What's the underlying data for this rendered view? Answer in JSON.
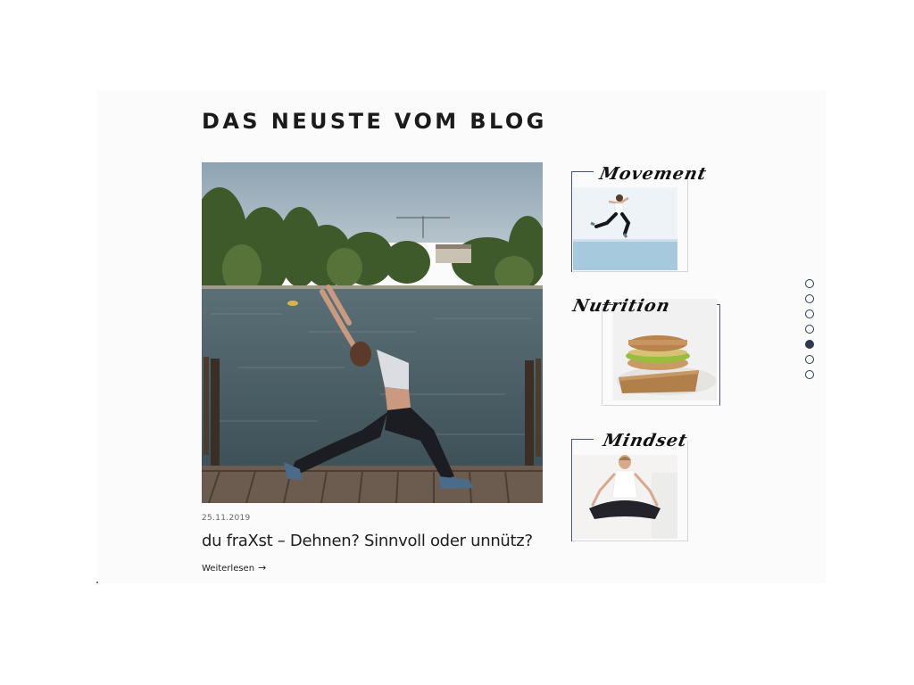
{
  "blog": {
    "heading": "DAS NEUSTE VOM BLOG",
    "post": {
      "date": "25.11.2019",
      "title": "du fraXst – Dehnen? Sinnvoll oder unnütz?",
      "read_more": "Weiterlesen",
      "read_more_arrow": "→",
      "image_icon": "yoga-stretch-lakeside-photo"
    },
    "categories": [
      {
        "label": "Movement",
        "icon": "jumping-woman-photo"
      },
      {
        "label": "Nutrition",
        "icon": "avocado-sandwich-photo"
      },
      {
        "label": "Mindset",
        "icon": "meditating-woman-photo"
      }
    ]
  },
  "slider_nav": {
    "count": 7,
    "active_index": 4
  },
  "colors": {
    "panel_bg": "#fbfbfb",
    "accent_dark": "#2c3a4f",
    "text": "#1d1d1d"
  }
}
